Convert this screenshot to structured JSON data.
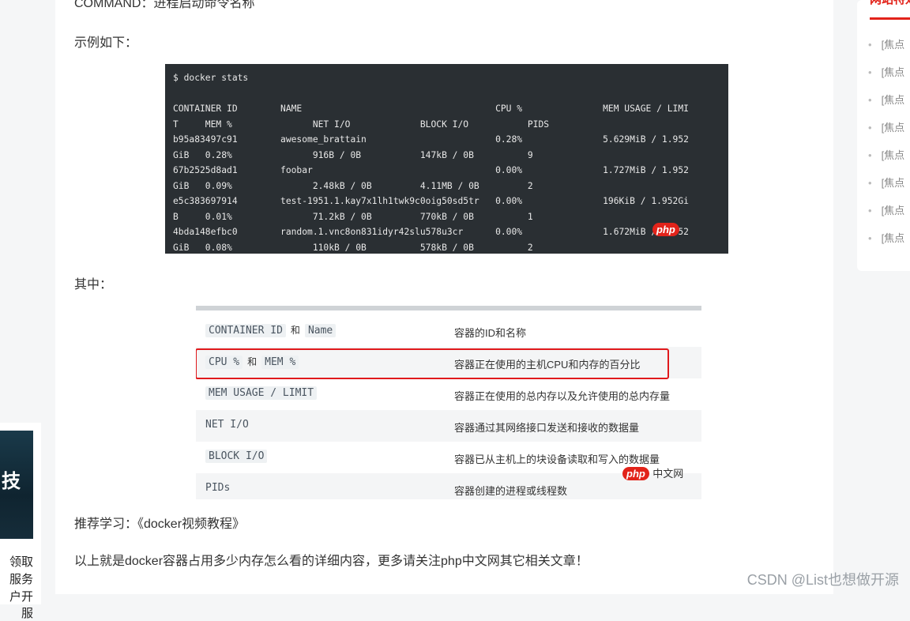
{
  "article": {
    "command_line": "COMMAND：进程启动命令名称",
    "example_label": "示例如下：",
    "terminal_lines": [
      "$ docker stats",
      "",
      "CONTAINER ID        NAME                                    CPU %               MEM USAGE / LIMI",
      "T     MEM %               NET I/O             BLOCK I/O           PIDS",
      "b95a83497c91        awesome_brattain                        0.28%               5.629MiB / 1.952",
      "GiB   0.28%               916B / 0B           147kB / 0B          9",
      "67b2525d8ad1        foobar                                  0.00%               1.727MiB / 1.952",
      "GiB   0.09%               2.48kB / 0B         4.11MB / 0B         2",
      "e5c383697914        test-1951.1.kay7x1lh1twk9c0oig50sd5tr   0.00%               196KiB / 1.952Gi",
      "B     0.01%               71.2kB / 0B         770kB / 0B          1",
      "4bda148efbc0        random.1.vnc8on831idyr42slu578u3cr      0.00%               1.672MiB / 1.952",
      "GiB   0.08%               110kB / 0B          578kB / 0B          2"
    ],
    "terminal_watermark": "php",
    "where_label": "其中：",
    "table_rows": [
      {
        "a": "CONTAINER ID",
        "conj": "和",
        "b": "Name",
        "desc": "容器的ID和名称"
      },
      {
        "a": "CPU %",
        "conj": "和",
        "b": "MEM %",
        "desc": "容器正在使用的主机CPU和内存的百分比"
      },
      {
        "a": "MEM USAGE / LIMIT",
        "conj": "",
        "b": "",
        "desc": "容器正在使用的总内存以及允许使用的总内存量"
      },
      {
        "a": "NET I/O",
        "conj": "",
        "b": "",
        "desc": "容器通过其网络接口发送和接收的数据量"
      },
      {
        "a": "BLOCK I/O",
        "conj": "",
        "b": "",
        "desc": "容器已从主机上的块设备读取和写入的数据量"
      },
      {
        "a": "PIDs",
        "conj": "",
        "b": "",
        "desc": "容器创建的进程或线程数"
      }
    ],
    "table_watermark": {
      "pill": "php",
      "text": "中文网"
    },
    "recommend_text": "推荐学习：《docker视频教程》",
    "summary_text": "以上就是docker容器占用多少内存怎么看的详细内容，更多请关注php中文网其它相关文章！"
  },
  "sidebar": {
    "title": "网站特效",
    "items": [
      "[焦点",
      "[焦点",
      "[焦点",
      "[焦点",
      "[焦点",
      "[焦点",
      "[焦点",
      "[焦点"
    ]
  },
  "left_promo": {
    "image_glyph": "技",
    "lines": [
      "领取",
      "服务",
      "户开服"
    ]
  },
  "footer_watermark": "CSDN @List也想做开源",
  "colors": {
    "accent_red": "#e2231a",
    "terminal_bg": "#2a2f33",
    "highlight_box": "#e0191c"
  }
}
